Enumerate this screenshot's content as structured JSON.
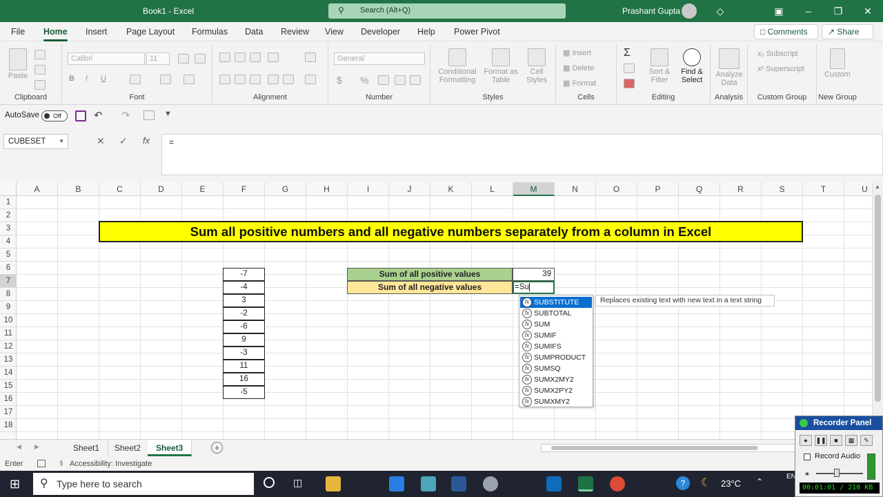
{
  "titlebar": {
    "doc_title": "Book1  -  Excel",
    "search_placeholder": "Search (Alt+Q)",
    "user": "Prashant Gupta"
  },
  "menu": {
    "items": [
      "File",
      "Home",
      "Insert",
      "Page Layout",
      "Formulas",
      "Data",
      "Review",
      "View",
      "Developer",
      "Help",
      "Power Pivot"
    ],
    "comments": "Comments",
    "share": "Share"
  },
  "ribbon": {
    "clipboard": {
      "label": "Clipboard",
      "paste": "Paste"
    },
    "font": {
      "label": "Font",
      "name": "Calibri",
      "size": "11"
    },
    "alignment": {
      "label": "Alignment"
    },
    "number": {
      "label": "Number",
      "format": "General"
    },
    "styles": {
      "label": "Styles",
      "conditional": "Conditional Formatting",
      "format_as": "Format as Table",
      "cell_styles": "Cell Styles"
    },
    "cells": {
      "label": "Cells",
      "insert": "Insert",
      "delete": "Delete",
      "format": "Format"
    },
    "editing": {
      "label": "Editing",
      "sort": "Sort & Filter",
      "find": "Find & Select"
    },
    "analysis": {
      "label": "Analysis",
      "analyze": "Analyze Data"
    },
    "custom_group": {
      "label": "Custom Group",
      "subscript": "Subscript",
      "superscript": "Superscript"
    },
    "new_group": {
      "label": "New Group",
      "custom": "Custom"
    }
  },
  "qat": {
    "autosave": "AutoSave",
    "toggle": "Off"
  },
  "formula_bar": {
    "name_box": "CUBESET",
    "formula": "="
  },
  "columns": [
    "A",
    "B",
    "C",
    "D",
    "E",
    "F",
    "G",
    "H",
    "I",
    "J",
    "K",
    "L",
    "M",
    "N",
    "O",
    "P",
    "Q",
    "R",
    "S",
    "T",
    "U"
  ],
  "rows": [
    "1",
    "2",
    "3",
    "4",
    "5",
    "6",
    "7",
    "8",
    "9",
    "10",
    "11",
    "12",
    "13",
    "14",
    "15",
    "16",
    "17",
    "18"
  ],
  "sheet": {
    "title": "Sum all positive numbers and all negative numbers separately from a column in Excel",
    "values": [
      "-7",
      "-4",
      "3",
      "-2",
      "-6",
      "9",
      "-3",
      "11",
      "16",
      "-5"
    ],
    "pos_label": "Sum of all positive values",
    "pos_value": "39",
    "neg_label": "Sum of all negative values",
    "neg_editing": "=Su"
  },
  "autocomplete": {
    "items": [
      "SUBSTITUTE",
      "SUBTOTAL",
      "SUM",
      "SUMIF",
      "SUMIFS",
      "SUMPRODUCT",
      "SUMSQ",
      "SUMX2MY2",
      "SUMX2PY2",
      "SUMXMY2"
    ],
    "tooltip": "Replaces existing text with new text in a text string"
  },
  "tabs": [
    "Sheet1",
    "Sheet2",
    "Sheet3"
  ],
  "status": {
    "mode": "Enter",
    "accessibility": "Accessibility: Investigate"
  },
  "taskbar": {
    "search": "Type here to search",
    "temperature": "23°C",
    "lang": "EN"
  },
  "recorder": {
    "title": "Recorder Panel",
    "record_audio": "Record Audio",
    "time": "00:01:01 / 210 KB"
  }
}
